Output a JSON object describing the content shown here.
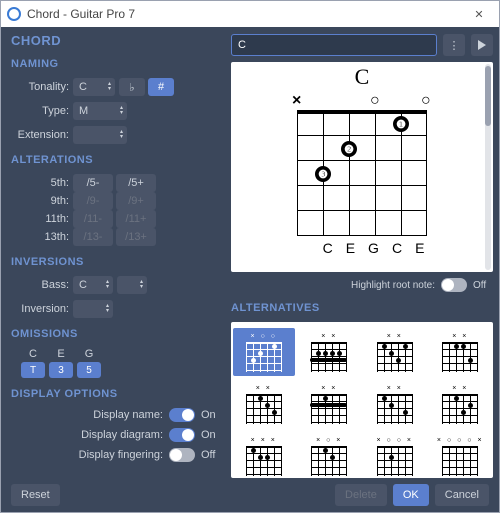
{
  "title": "Chord - Guitar Pro 7",
  "header": "CHORD",
  "chord_name": "C",
  "naming": {
    "section": "NAMING",
    "tonality_label": "Tonality:",
    "tonality_value": "C",
    "flat": "♭",
    "sharp": "#",
    "type_label": "Type:",
    "type_value": "M",
    "extension_label": "Extension:",
    "extension_value": ""
  },
  "alterations": {
    "section": "ALTERATIONS",
    "rows": [
      {
        "label": "5th:",
        "minus": "/5-",
        "plus": "/5+",
        "active": true
      },
      {
        "label": "9th:",
        "minus": "/9-",
        "plus": "/9+",
        "active": false
      },
      {
        "label": "11th:",
        "minus": "/11-",
        "plus": "/11+",
        "active": false
      },
      {
        "label": "13th:",
        "minus": "/13-",
        "plus": "/13+",
        "active": false
      }
    ]
  },
  "inversions": {
    "section": "INVERSIONS",
    "bass_label": "Bass:",
    "bass_value": "C",
    "inversion_label": "Inversion:",
    "inversion_value": ""
  },
  "omissions": {
    "section": "OMISSIONS",
    "items": [
      {
        "note": "C",
        "interval": "T"
      },
      {
        "note": "E",
        "interval": "3"
      },
      {
        "note": "G",
        "interval": "5"
      }
    ]
  },
  "display": {
    "section": "DISPLAY OPTIONS",
    "name_label": "Display name:",
    "name_state": "On",
    "diagram_label": "Display diagram:",
    "diagram_state": "On",
    "fingering_label": "Display fingering:",
    "fingering_state": "Off"
  },
  "preview": {
    "name": "C",
    "strings": [
      "×",
      "",
      "",
      "○",
      "",
      "○"
    ],
    "note_labels": [
      "",
      "C",
      "E",
      "G",
      "C",
      "E"
    ]
  },
  "highlight": {
    "label": "Highlight root note:",
    "state": "Off"
  },
  "alternatives": {
    "section": "ALTERNATIVES",
    "items": [
      {
        "top": "×     ○   ○"
      },
      {
        "top": "× ×"
      },
      {
        "top": "× ×"
      },
      {
        "top": "× ×"
      },
      {
        "top": "× ×"
      },
      {
        "top": "× ×"
      },
      {
        "top": "× ×"
      },
      {
        "top": "× ×"
      },
      {
        "top": "× ×         ×"
      },
      {
        "top": "× ○         ×"
      },
      {
        "top": "× ○       ○ ×"
      },
      {
        "top": "× ○ ○     ○ ×"
      }
    ]
  },
  "buttons": {
    "reset": "Reset",
    "delete": "Delete",
    "ok": "OK",
    "cancel": "Cancel"
  }
}
